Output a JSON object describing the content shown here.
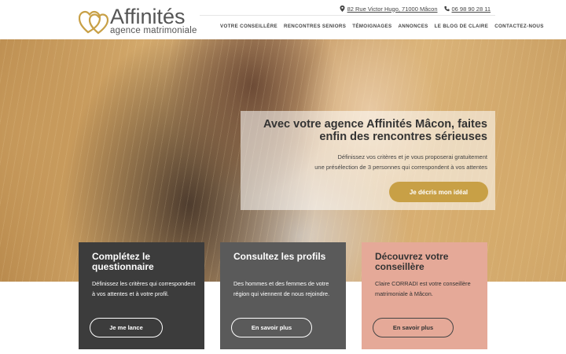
{
  "brand": {
    "name": "Affinités",
    "tagline": "agence matrimoniale",
    "accent": "#c8a046"
  },
  "contact": {
    "address": "82 Rue Victor Hugo, 71000 Mâcon",
    "phone": "06 98 90 28 11",
    "address_icon": "map-pin-icon",
    "phone_icon": "phone-icon"
  },
  "nav": {
    "items": [
      {
        "label": "VOTRE CONSEILLÈRE"
      },
      {
        "label": "RENCONTRES SENIORS"
      },
      {
        "label": "TÉMOIGNAGES"
      },
      {
        "label": "ANNONCES"
      },
      {
        "label": "LE BLOG DE CLAIRE"
      },
      {
        "label": "CONTACTEZ-NOUS"
      }
    ]
  },
  "hero": {
    "title": "Avec votre agence Affinités Mâcon, faites enfin des rencontres sérieuses",
    "text_line1": "Définissez vos critères et je vous proposerai gratuitement",
    "text_line2": "une présélection de 3 personnes qui correspondent à vos attentes",
    "cta_label": "Je décris mon idéal"
  },
  "cards": [
    {
      "title": "Complétez le questionnaire",
      "text": "Définissez les critères qui correspondent à vos attentes et à votre profil.",
      "button": "Je me lance",
      "color": "#3c3c3c"
    },
    {
      "title": "Consultez les profils",
      "text": "Des hommes et des femmes de votre région qui viennent de nous rejoindre.",
      "button": "En savoir plus",
      "color": "#5a5a5a"
    },
    {
      "title": "Découvrez votre conseillère",
      "text": "Claire CORRADI est votre conseillère matrimoniale à Mâcon.",
      "button": "En savoir plus",
      "color": "#e5a998"
    }
  ]
}
